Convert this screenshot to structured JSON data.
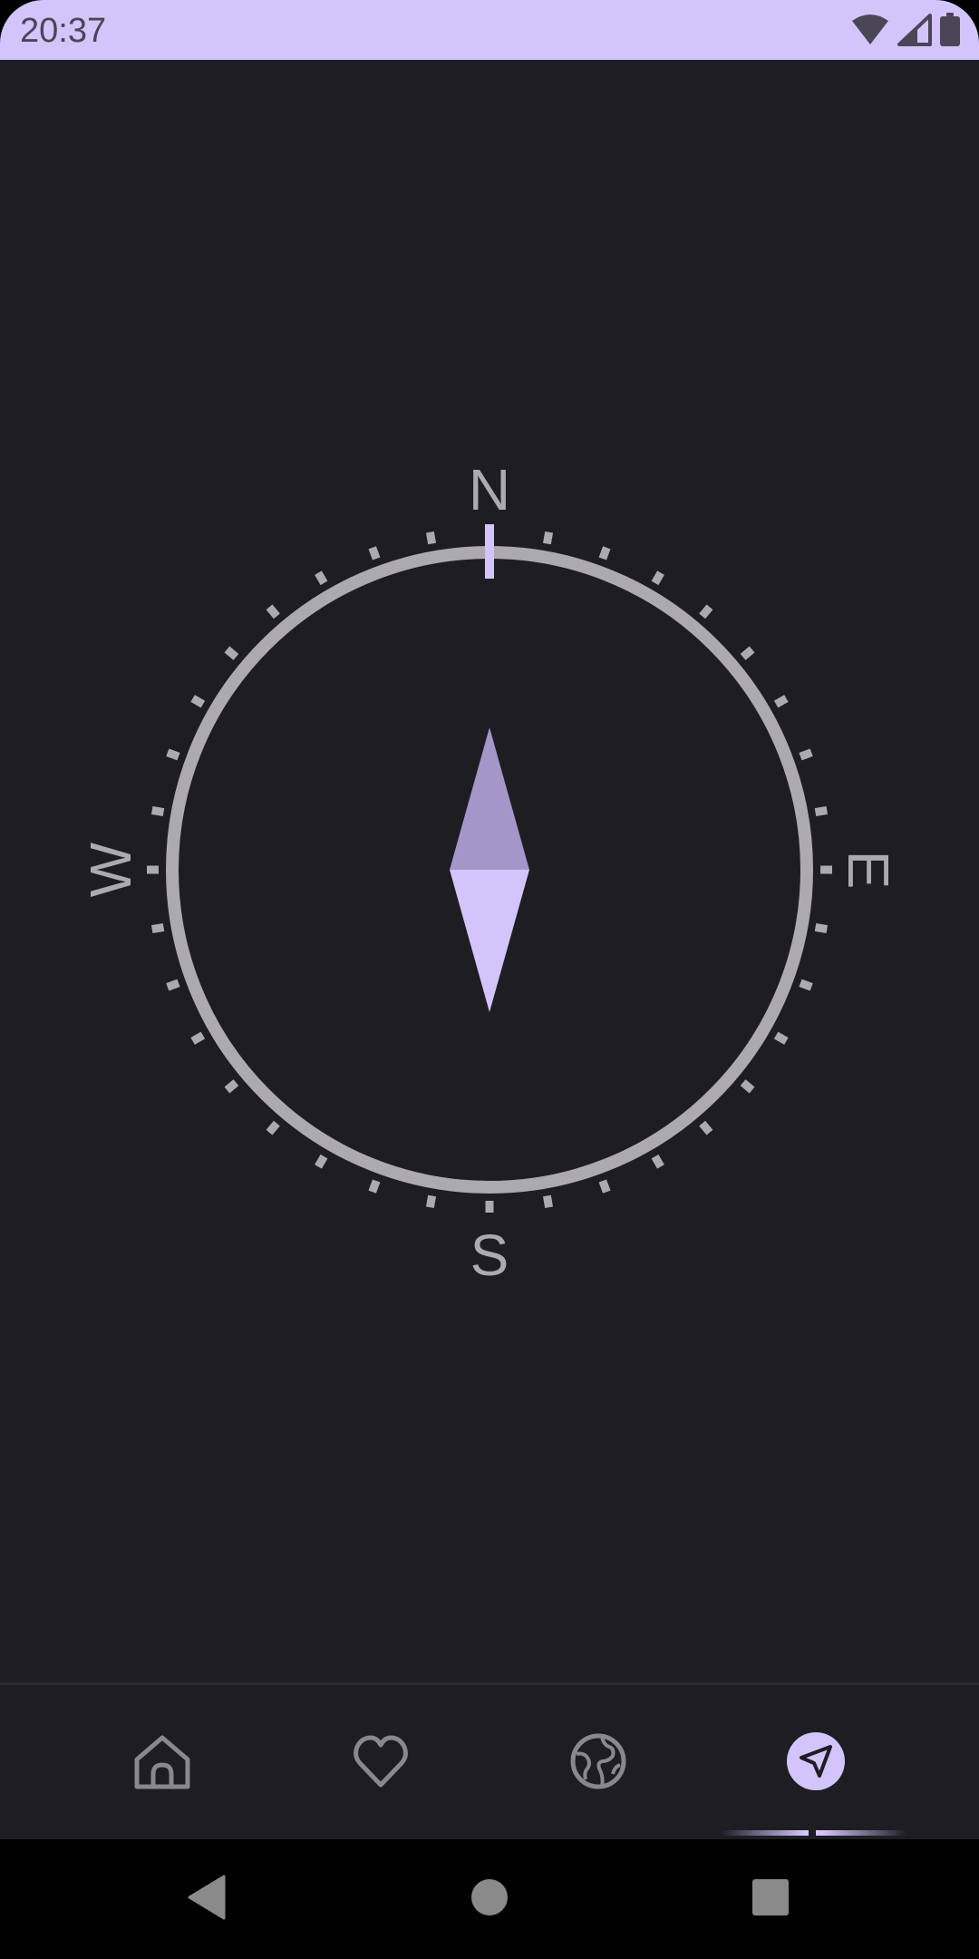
{
  "status_bar": {
    "time": "20:37",
    "icons": [
      "wifi-icon",
      "cellular-signal-icon",
      "battery-icon"
    ],
    "background": "#d3c4fc"
  },
  "compass": {
    "heading_degrees": 0,
    "labels": {
      "north": "N",
      "east": "E",
      "south": "S",
      "west": "W"
    },
    "colors": {
      "ring": "#acaaaf",
      "ticks": "#acaaaf",
      "north_marker": "#d3c4fc",
      "needle_north": "#a496c8",
      "needle_south": "#d3c4fc",
      "label": "#acaaaf"
    }
  },
  "bottom_nav": {
    "items": [
      {
        "name": "home",
        "icon": "home-icon",
        "active": false
      },
      {
        "name": "favorites",
        "icon": "heart-icon",
        "active": false
      },
      {
        "name": "globe",
        "icon": "globe-icon",
        "active": false
      },
      {
        "name": "navigation",
        "icon": "navigation-arrow-icon",
        "active": true
      }
    ],
    "active_color": "#d3c4fc",
    "inactive_color": "#8a888d"
  },
  "system_nav": {
    "buttons": [
      "back-icon",
      "home-circle-icon",
      "recents-icon"
    ],
    "color": "#8a8a8a"
  }
}
